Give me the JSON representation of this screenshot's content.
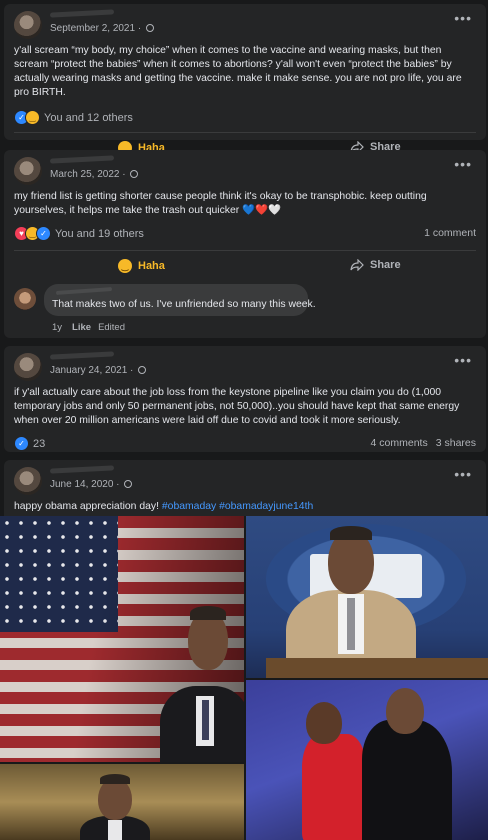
{
  "posts": [
    {
      "date": "September 2, 2021 ·",
      "text": "y'all scream “my body, my choice” when it comes to the vaccine and wearing masks, but then scream “protect the babies” when it comes to abortions? y'all won't even “protect the babies” by actually wearing masks and getting the vaccine. make it make sense. you are not pro life, you are pro BIRTH.",
      "reactions": "You and 12 others",
      "action_haha": "Haha",
      "action_share": "Share"
    },
    {
      "date": "March 25, 2022 ·",
      "text": "my friend list is getting shorter cause people think it's okay to be transphobic. keep outting yourselves, it helps me take the trash out quicker 💙❤️🤍",
      "reactions": "You and 19 others",
      "comments": "1 comment",
      "action_haha": "Haha",
      "action_share": "Share",
      "comment": {
        "text": "That makes two of us. I've unfriended so many this week.",
        "time": "1y",
        "like": "Like",
        "edited": "Edited"
      }
    },
    {
      "date": "January 24, 2021 ·",
      "text": "if y'all actually care about the job loss from the keystone pipeline like you claim you do (1,000 temporary jobs and only 50 permanent jobs, not 50,000)..you should have kept that same energy when over 20 million americans were laid off due to covid and took it more seriously.",
      "reactions": "23",
      "comments": "4 comments",
      "shares": "3 shares"
    },
    {
      "date": "June 14, 2020 ·",
      "text": "happy obama appreciation day! ",
      "tags": "#obamaday #obamadayjune14th"
    }
  ],
  "icons": {
    "more": "more-icon",
    "privacy": "globe-icon",
    "like": "like-icon",
    "haha": "haha-icon",
    "love": "love-icon",
    "share": "share-icon"
  },
  "colors": {
    "accent": "#2d88ff",
    "haha": "#f7b928",
    "love": "#f33e58",
    "background": "#18191a",
    "card": "#242526"
  }
}
